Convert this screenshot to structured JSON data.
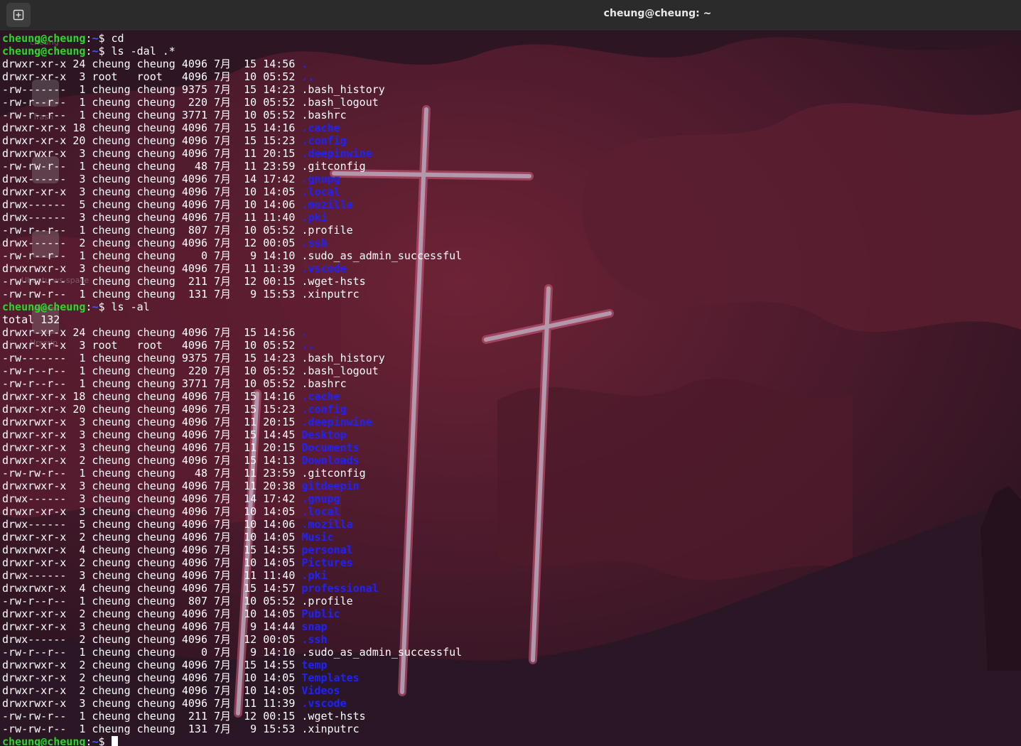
{
  "window": {
    "title": "cheung@cheung: ~"
  },
  "colors": {
    "prompt_user": "#2bd82b",
    "prompt_path": "#3b5bf2",
    "directory": "#1e22ff",
    "text": "#ffffff",
    "titlebar": "#2b2b2b"
  },
  "icons": {
    "new_tab": "new-tab-icon"
  },
  "desktop_ghost_labels": [
    "cheung",
    "Trash",
    "Ubuntu-ws-space",
    "Hrscrip"
  ],
  "prompt": {
    "user": "cheung@cheung",
    "sep": ":",
    "path": "~",
    "suffix": "$ "
  },
  "terminal": {
    "lines": [
      {
        "type": "prompt",
        "cmd": "cd"
      },
      {
        "type": "prompt",
        "cmd": "ls -dal .*"
      },
      {
        "type": "entry",
        "meta": "drwxr-xr-x 24 cheung cheung 4096 7月  15 14:56 ",
        "name": ".",
        "dir": true
      },
      {
        "type": "entry",
        "meta": "drwxr-xr-x  3 root   root   4096 7月  10 05:52 ",
        "name": "..",
        "dir": true
      },
      {
        "type": "entry",
        "meta": "-rw-------  1 cheung cheung 9375 7月  15 14:23 ",
        "name": ".bash_history",
        "dir": false
      },
      {
        "type": "entry",
        "meta": "-rw-r--r--  1 cheung cheung  220 7月  10 05:52 ",
        "name": ".bash_logout",
        "dir": false
      },
      {
        "type": "entry",
        "meta": "-rw-r--r--  1 cheung cheung 3771 7月  10 05:52 ",
        "name": ".bashrc",
        "dir": false
      },
      {
        "type": "entry",
        "meta": "drwxr-xr-x 18 cheung cheung 4096 7月  15 14:16 ",
        "name": ".cache",
        "dir": true
      },
      {
        "type": "entry",
        "meta": "drwxr-xr-x 20 cheung cheung 4096 7月  15 15:23 ",
        "name": ".config",
        "dir": true
      },
      {
        "type": "entry",
        "meta": "drwxrwxr-x  3 cheung cheung 4096 7月  11 20:15 ",
        "name": ".deepinwine",
        "dir": true
      },
      {
        "type": "entry",
        "meta": "-rw-rw-r--  1 cheung cheung   48 7月  11 23:59 ",
        "name": ".gitconfig",
        "dir": false
      },
      {
        "type": "entry",
        "meta": "drwx------  3 cheung cheung 4096 7月  14 17:42 ",
        "name": ".gnupg",
        "dir": true
      },
      {
        "type": "entry",
        "meta": "drwxr-xr-x  3 cheung cheung 4096 7月  10 14:05 ",
        "name": ".local",
        "dir": true
      },
      {
        "type": "entry",
        "meta": "drwx------  5 cheung cheung 4096 7月  10 14:06 ",
        "name": ".mozilla",
        "dir": true
      },
      {
        "type": "entry",
        "meta": "drwx------  3 cheung cheung 4096 7月  11 11:40 ",
        "name": ".pki",
        "dir": true
      },
      {
        "type": "entry",
        "meta": "-rw-r--r--  1 cheung cheung  807 7月  10 05:52 ",
        "name": ".profile",
        "dir": false
      },
      {
        "type": "entry",
        "meta": "drwx------  2 cheung cheung 4096 7月  12 00:05 ",
        "name": ".ssh",
        "dir": true
      },
      {
        "type": "entry",
        "meta": "-rw-r--r--  1 cheung cheung    0 7月   9 14:10 ",
        "name": ".sudo_as_admin_successful",
        "dir": false
      },
      {
        "type": "entry",
        "meta": "drwxrwxr-x  3 cheung cheung 4096 7月  11 11:39 ",
        "name": ".vscode",
        "dir": true
      },
      {
        "type": "entry",
        "meta": "-rw-rw-r--  1 cheung cheung  211 7月  12 00:15 ",
        "name": ".wget-hsts",
        "dir": false
      },
      {
        "type": "entry",
        "meta": "-rw-rw-r--  1 cheung cheung  131 7月   9 15:53 ",
        "name": ".xinputrc",
        "dir": false
      },
      {
        "type": "prompt",
        "cmd": "ls -al"
      },
      {
        "type": "text",
        "text": "total 132"
      },
      {
        "type": "entry",
        "meta": "drwxr-xr-x 24 cheung cheung 4096 7月  15 14:56 ",
        "name": ".",
        "dir": true
      },
      {
        "type": "entry",
        "meta": "drwxr-xr-x  3 root   root   4096 7月  10 05:52 ",
        "name": "..",
        "dir": true
      },
      {
        "type": "entry",
        "meta": "-rw-------  1 cheung cheung 9375 7月  15 14:23 ",
        "name": ".bash_history",
        "dir": false
      },
      {
        "type": "entry",
        "meta": "-rw-r--r--  1 cheung cheung  220 7月  10 05:52 ",
        "name": ".bash_logout",
        "dir": false
      },
      {
        "type": "entry",
        "meta": "-rw-r--r--  1 cheung cheung 3771 7月  10 05:52 ",
        "name": ".bashrc",
        "dir": false
      },
      {
        "type": "entry",
        "meta": "drwxr-xr-x 18 cheung cheung 4096 7月  15 14:16 ",
        "name": ".cache",
        "dir": true
      },
      {
        "type": "entry",
        "meta": "drwxr-xr-x 20 cheung cheung 4096 7月  15 15:23 ",
        "name": ".config",
        "dir": true
      },
      {
        "type": "entry",
        "meta": "drwxrwxr-x  3 cheung cheung 4096 7月  11 20:15 ",
        "name": ".deepinwine",
        "dir": true
      },
      {
        "type": "entry",
        "meta": "drwxr-xr-x  3 cheung cheung 4096 7月  15 14:45 ",
        "name": "Desktop",
        "dir": true
      },
      {
        "type": "entry",
        "meta": "drwxr-xr-x  3 cheung cheung 4096 7月  11 20:15 ",
        "name": "Documents",
        "dir": true
      },
      {
        "type": "entry",
        "meta": "drwxr-xr-x  2 cheung cheung 4096 7月  15 14:13 ",
        "name": "Downloads",
        "dir": true
      },
      {
        "type": "entry",
        "meta": "-rw-rw-r--  1 cheung cheung   48 7月  11 23:59 ",
        "name": ".gitconfig",
        "dir": false
      },
      {
        "type": "entry",
        "meta": "drwxrwxr-x  3 cheung cheung 4096 7月  11 20:38 ",
        "name": "gitdeepin",
        "dir": true
      },
      {
        "type": "entry",
        "meta": "drwx------  3 cheung cheung 4096 7月  14 17:42 ",
        "name": ".gnupg",
        "dir": true
      },
      {
        "type": "entry",
        "meta": "drwxr-xr-x  3 cheung cheung 4096 7月  10 14:05 ",
        "name": ".local",
        "dir": true
      },
      {
        "type": "entry",
        "meta": "drwx------  5 cheung cheung 4096 7月  10 14:06 ",
        "name": ".mozilla",
        "dir": true
      },
      {
        "type": "entry",
        "meta": "drwxr-xr-x  2 cheung cheung 4096 7月  10 14:05 ",
        "name": "Music",
        "dir": true
      },
      {
        "type": "entry",
        "meta": "drwxrwxr-x  4 cheung cheung 4096 7月  15 14:55 ",
        "name": "personal",
        "dir": true
      },
      {
        "type": "entry",
        "meta": "drwxr-xr-x  2 cheung cheung 4096 7月  10 14:05 ",
        "name": "Pictures",
        "dir": true
      },
      {
        "type": "entry",
        "meta": "drwx------  3 cheung cheung 4096 7月  11 11:40 ",
        "name": ".pki",
        "dir": true
      },
      {
        "type": "entry",
        "meta": "drwxrwxr-x  4 cheung cheung 4096 7月  15 14:57 ",
        "name": "professional",
        "dir": true
      },
      {
        "type": "entry",
        "meta": "-rw-r--r--  1 cheung cheung  807 7月  10 05:52 ",
        "name": ".profile",
        "dir": false
      },
      {
        "type": "entry",
        "meta": "drwxr-xr-x  2 cheung cheung 4096 7月  10 14:05 ",
        "name": "Public",
        "dir": true
      },
      {
        "type": "entry",
        "meta": "drwxr-xr-x  3 cheung cheung 4096 7月   9 14:44 ",
        "name": "snap",
        "dir": true
      },
      {
        "type": "entry",
        "meta": "drwx------  2 cheung cheung 4096 7月  12 00:05 ",
        "name": ".ssh",
        "dir": true
      },
      {
        "type": "entry",
        "meta": "-rw-r--r--  1 cheung cheung    0 7月   9 14:10 ",
        "name": ".sudo_as_admin_successful",
        "dir": false
      },
      {
        "type": "entry",
        "meta": "drwxrwxr-x  2 cheung cheung 4096 7月  15 14:55 ",
        "name": "temp",
        "dir": true
      },
      {
        "type": "entry",
        "meta": "drwxr-xr-x  2 cheung cheung 4096 7月  10 14:05 ",
        "name": "Templates",
        "dir": true
      },
      {
        "type": "entry",
        "meta": "drwxr-xr-x  2 cheung cheung 4096 7月  10 14:05 ",
        "name": "Videos",
        "dir": true
      },
      {
        "type": "entry",
        "meta": "drwxrwxr-x  3 cheung cheung 4096 7月  11 11:39 ",
        "name": ".vscode",
        "dir": true
      },
      {
        "type": "entry",
        "meta": "-rw-rw-r--  1 cheung cheung  211 7月  12 00:15 ",
        "name": ".wget-hsts",
        "dir": false
      },
      {
        "type": "entry",
        "meta": "-rw-rw-r--  1 cheung cheung  131 7月   9 15:53 ",
        "name": ".xinputrc",
        "dir": false
      },
      {
        "type": "prompt",
        "cmd": "",
        "cursor": true
      }
    ]
  }
}
